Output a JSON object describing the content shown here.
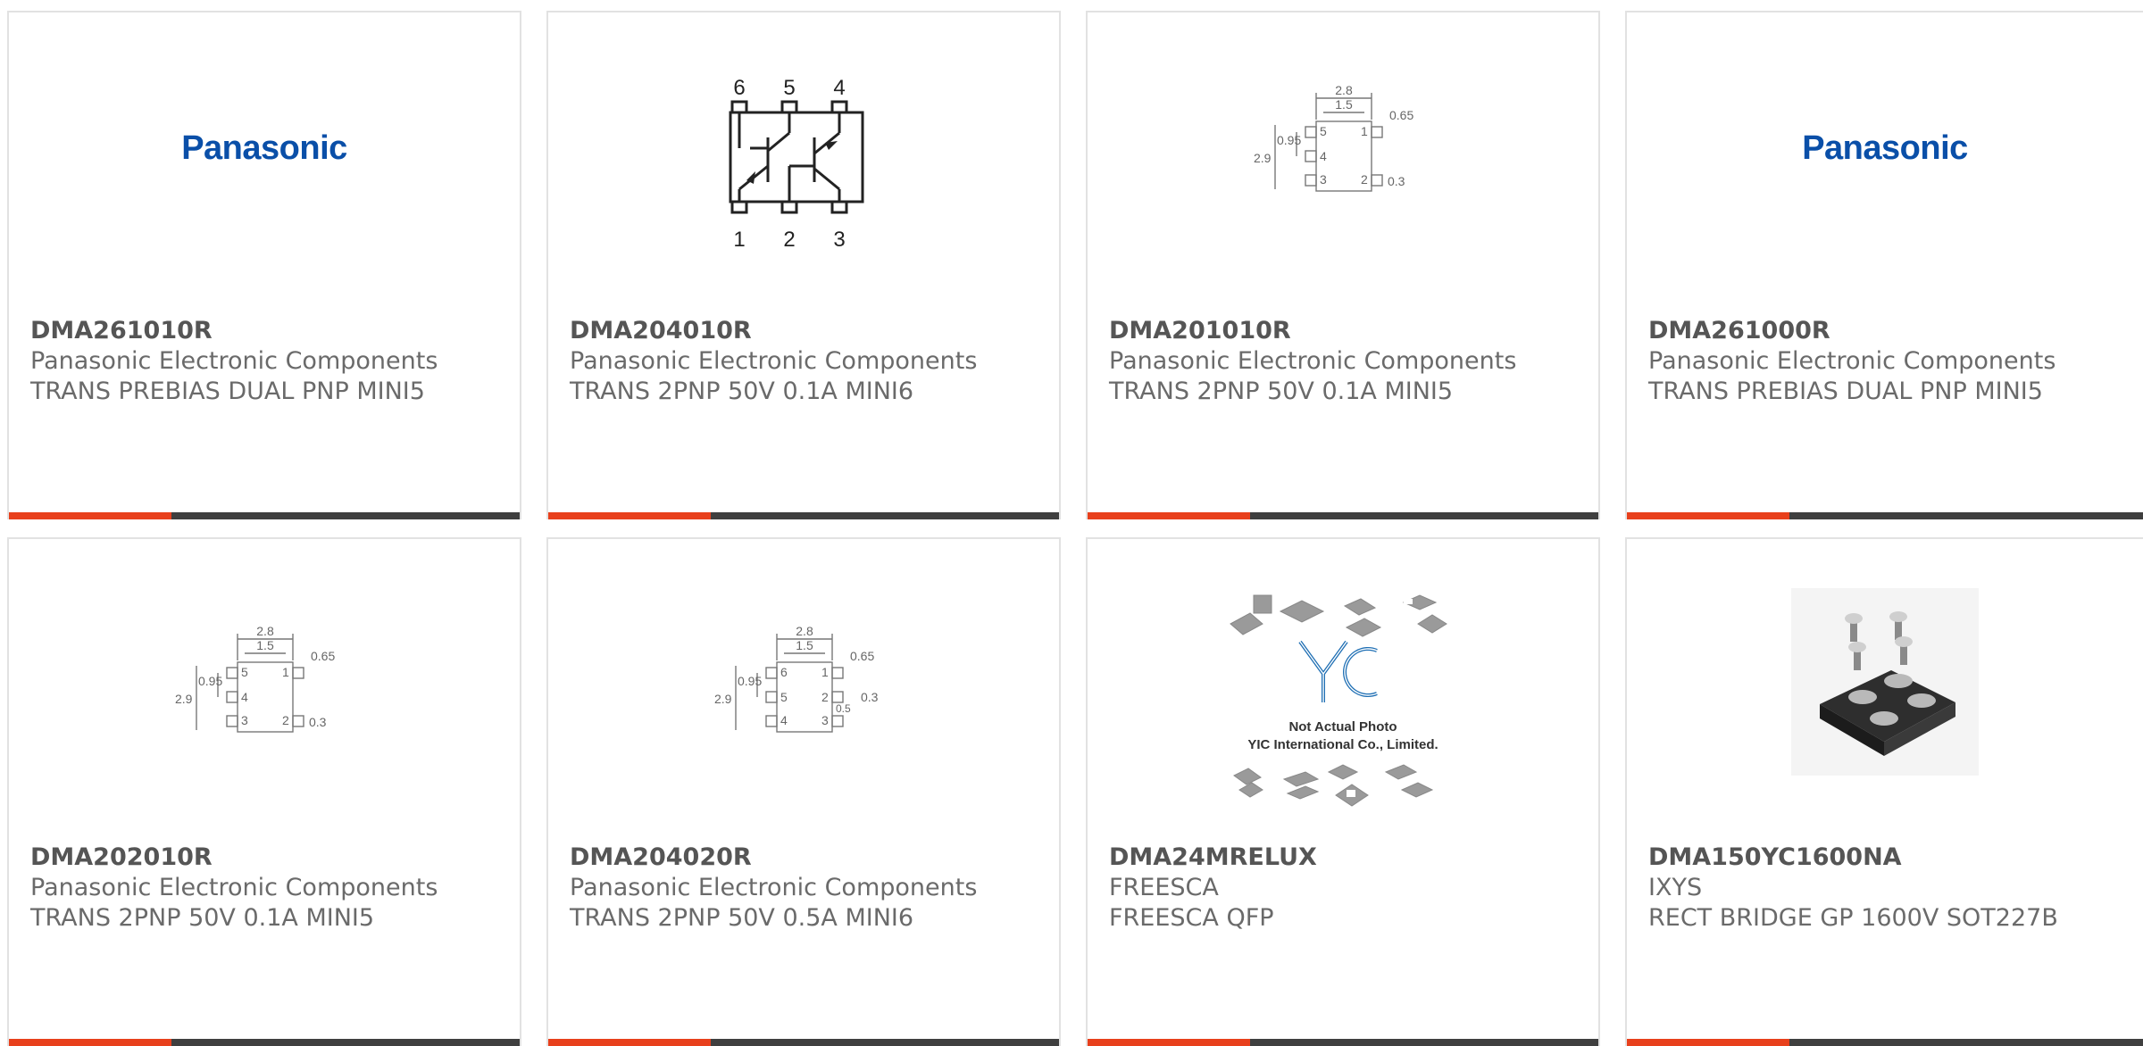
{
  "colors": {
    "accent": "#e8401c",
    "bar": "#3f3f3f",
    "panasonic_blue": "#0a4fa8",
    "border": "#e2e2e2"
  },
  "products": [
    {
      "part": "DMA261010R",
      "manufacturer": "Panasonic Electronic Components",
      "description": "TRANS PREBIAS DUAL PNP MINI5",
      "image": "panasonic-logo",
      "logo_text": "Panasonic"
    },
    {
      "part": "DMA204010R",
      "manufacturer": "Panasonic Electronic Components",
      "description": "TRANS 2PNP 50V 0.1A MINI6",
      "image": "circuit-schematic",
      "pins_top": [
        "6",
        "5",
        "4"
      ],
      "pins_bottom": [
        "1",
        "2",
        "3"
      ]
    },
    {
      "part": "DMA201010R",
      "manufacturer": "Panasonic Electronic Components",
      "description": "TRANS 2PNP 50V 0.1A MINI5",
      "image": "package-dimension-drawing",
      "dims": {
        "w_outer": "2.8",
        "w_inner": "1.5",
        "lead": "0.65",
        "pitch": "0.95",
        "h": "2.9",
        "lead_w": "0.3"
      },
      "pins": [
        "5",
        "1",
        "4",
        "3",
        "2"
      ]
    },
    {
      "part": "DMA261000R",
      "manufacturer": "Panasonic Electronic Components",
      "description": "TRANS PREBIAS DUAL PNP MINI5",
      "image": "panasonic-logo",
      "logo_text": "Panasonic"
    },
    {
      "part": "DMA202010R",
      "manufacturer": "Panasonic Electronic Components",
      "description": "TRANS 2PNP 50V 0.1A MINI5",
      "image": "package-dimension-drawing",
      "dims": {
        "w_outer": "2.8",
        "w_inner": "1.5",
        "lead": "0.65",
        "pitch": "0.95",
        "h": "2.9",
        "lead_w": "0.3"
      },
      "pins": [
        "5",
        "1",
        "4",
        "3",
        "2"
      ]
    },
    {
      "part": "DMA204020R",
      "manufacturer": "Panasonic Electronic Components",
      "description": "TRANS 2PNP 50V 0.5A MINI6",
      "image": "package-dimension-drawing-6pin",
      "dims": {
        "w_outer": "2.8",
        "w_inner": "1.5",
        "lead": "0.65",
        "pitch": "0.95",
        "h": "2.9",
        "lead_w": "0.3",
        "pad": "0.5"
      },
      "pins": [
        "6",
        "1",
        "5",
        "2",
        "4",
        "3"
      ]
    },
    {
      "part": "DMA24MRELUX",
      "manufacturer": "FREESCA",
      "description": "FREESCA QFP",
      "image": "yic-placeholder",
      "photo_note_1": "Not Actual Photo",
      "photo_note_2": "YIC International Co., Limited."
    },
    {
      "part": "DMA150YC1600NA",
      "manufacturer": "IXYS",
      "description": "RECT BRIDGE GP 1600V SOT227B",
      "image": "module-photo"
    }
  ]
}
